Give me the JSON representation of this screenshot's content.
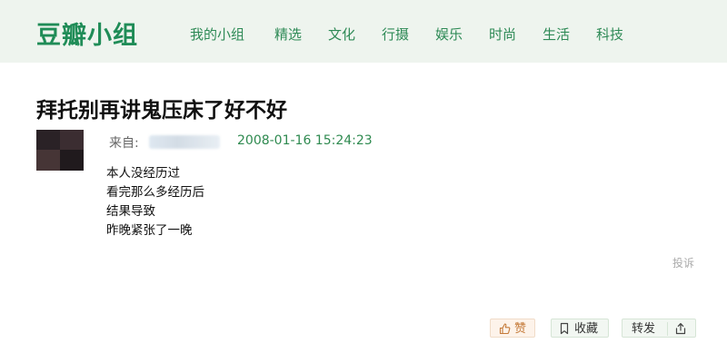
{
  "header": {
    "logo": "豆瓣小组",
    "nav": [
      "我的小组",
      "精选",
      "文化",
      "行摄",
      "娱乐",
      "时尚",
      "生活",
      "科技"
    ]
  },
  "post": {
    "title": "拜托别再讲鬼压床了好不好",
    "from_label": "来自:",
    "timestamp": "2008-01-16 15:24:23",
    "content": [
      "本人没经历过",
      "看完那么多经历后",
      "结果导致",
      "昨晚紧张了一晚"
    ],
    "report": "投诉"
  },
  "actions": {
    "like": "赞",
    "favorite": "收藏",
    "share": "转发"
  },
  "colors": {
    "brand": "#1f8c57",
    "nav_text": "#2e8a56",
    "header_bg": "#eef4ee",
    "timestamp": "#2f8a50",
    "like_accent": "#c57b3a"
  },
  "icons": {
    "like": "thumbs-up-icon",
    "favorite": "bookmark-icon",
    "share": "share-icon"
  }
}
